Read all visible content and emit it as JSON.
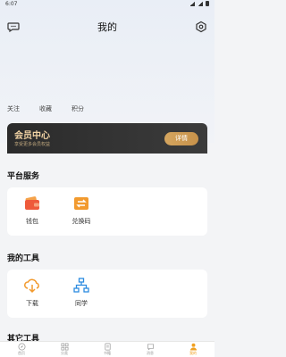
{
  "status_bar": {
    "time": "6:07"
  },
  "header": {
    "title": "我的"
  },
  "stats": {
    "follow": "关注",
    "favorites": "收藏",
    "points": "积分"
  },
  "vip": {
    "title": "会员中心",
    "subtitle": "享受更多会员权益",
    "button": "详情"
  },
  "platform_services": {
    "title": "平台服务",
    "items": [
      {
        "label": "钱包",
        "icon": "wallet-icon"
      },
      {
        "label": "兑换码",
        "icon": "voucher-icon"
      }
    ]
  },
  "my_tools": {
    "title": "我的工具",
    "items": [
      {
        "label": "下载",
        "icon": "cloud-download-icon"
      },
      {
        "label": "同学",
        "icon": "network-icon"
      }
    ]
  },
  "other_tools": {
    "title": "其它工具"
  },
  "bottom_nav": {
    "items": [
      {
        "label": "首页",
        "icon": "compass-icon"
      },
      {
        "label": "分类",
        "icon": "grid-icon"
      },
      {
        "label": "书籍",
        "icon": "book-icon"
      },
      {
        "label": "消息",
        "icon": "chat-icon"
      },
      {
        "label": "我的",
        "icon": "person-icon"
      }
    ],
    "active_index": 4
  },
  "colors": {
    "accent": "#f0a020",
    "vip_gold": "#d4a55f"
  }
}
